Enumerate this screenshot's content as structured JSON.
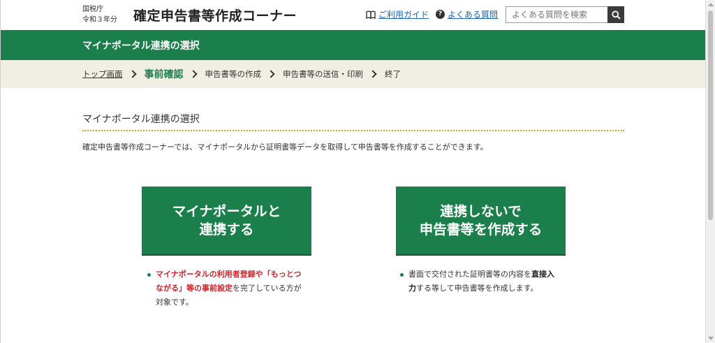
{
  "header": {
    "agency_line1": "国税庁",
    "agency_line2": "令和３年分",
    "site_title": "確定申告書等作成コーナー",
    "guide_link": "ご利用ガイド",
    "faq_link": "よくある質問",
    "search_placeholder": "よくある質問を検索",
    "icons": {
      "guide": "book-icon",
      "faq": "question-icon",
      "search": "search-icon"
    }
  },
  "greenbar": {
    "title": "マイナポータル連携の選択"
  },
  "steps": [
    {
      "label": "トップ画面",
      "state": "link"
    },
    {
      "label": "事前確認",
      "state": "current"
    },
    {
      "label": "申告書等の作成",
      "state": "upcoming"
    },
    {
      "label": "申告書等の送信・印刷",
      "state": "upcoming"
    },
    {
      "label": "終了",
      "state": "upcoming"
    }
  ],
  "main": {
    "heading": "マイナポータル連携の選択",
    "intro": "確定申告書等作成コーナーでは、マイナポータルから証明書等データを取得して申告書等を作成することができます。",
    "option_link": {
      "line1": "マイナポータルと",
      "line2": "連携する",
      "note_red1": "マイナポータルの利用者登録",
      "note_text1": "や「",
      "note_red2": "もっとつながる",
      "note_text2": "」等の",
      "note_red3": "事前設定",
      "note_text3": "を完了している方が対象です。"
    },
    "option_nolink": {
      "line1": "連携しないで",
      "line2": "申告書等を作成する",
      "note_text1": "書面で交付された証明書等の内容を",
      "note_bold": "直接入力",
      "note_text2": "する等して申告書等を作成します。"
    }
  },
  "colors": {
    "brand_green": "#1a7f4b",
    "link_blue": "#1a66b3",
    "accent_red": "#d0232a",
    "dotted_orange": "#e0a11a",
    "steps_bg": "#f1efe4"
  }
}
